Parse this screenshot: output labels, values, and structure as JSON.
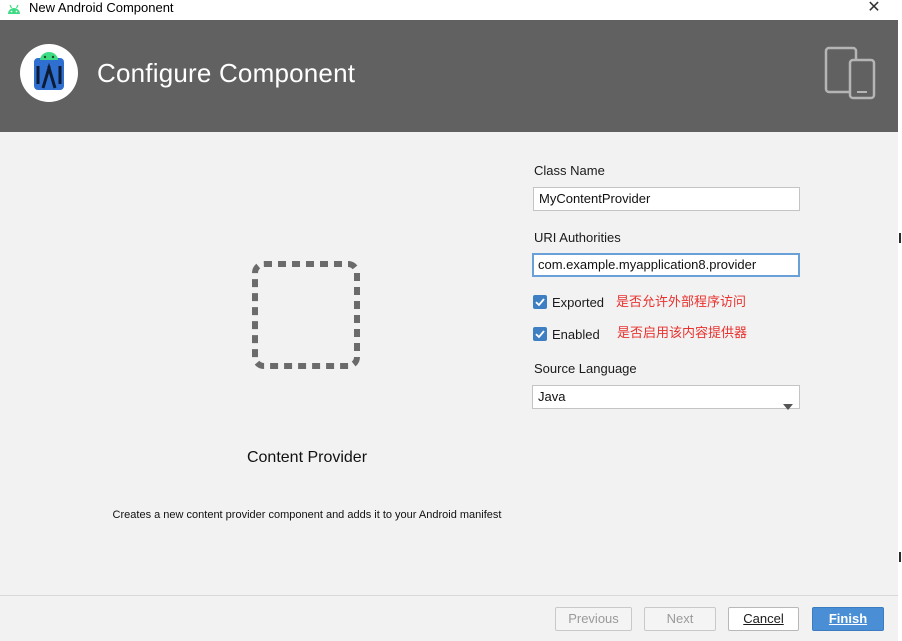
{
  "window": {
    "title": "New Android Component",
    "close_glyph": "✕",
    "app_icon": "android-icon"
  },
  "header": {
    "title": "Configure Component",
    "logo_icon": "android-studio-logo-icon",
    "devices_icon": "devices-icon",
    "background": "#616161"
  },
  "preview": {
    "icon": "content-provider-placeholder-icon",
    "title": "Content Provider",
    "description": "Creates a new content provider component and adds it to your Android manifest"
  },
  "form": {
    "class_name": {
      "label": "Class Name",
      "value": "MyContentProvider"
    },
    "uri_authorities": {
      "label": "URI Authorities",
      "value": "com.example.myapplication8.provider"
    },
    "exported": {
      "label": "Exported",
      "checked": true,
      "note": "是否允许外部程序访问"
    },
    "enabled": {
      "label": "Enabled",
      "checked": true,
      "note": "是否启用该内容提供器"
    },
    "source_language": {
      "label": "Source Language",
      "value": "Java",
      "options": [
        "Java"
      ]
    }
  },
  "footer": {
    "previous": "Previous",
    "next": "Next",
    "cancel": "Cancel",
    "finish": "Finish"
  },
  "colors": {
    "accent": "#4a8fd6",
    "checkbox": "#3e7fc3",
    "note_red": "#e8322e"
  }
}
